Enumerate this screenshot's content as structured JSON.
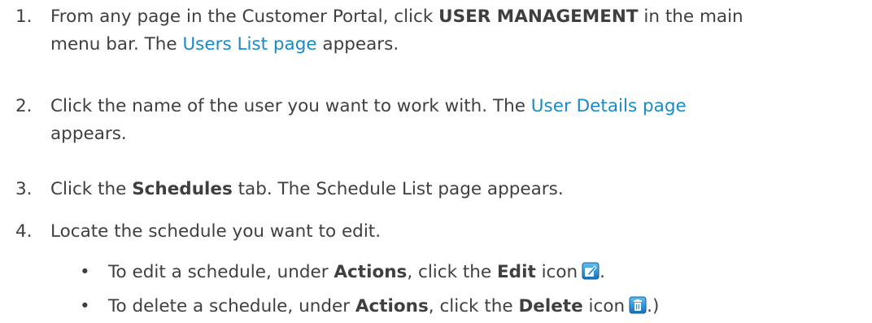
{
  "steps": [
    {
      "num": "1.",
      "a": "From any page in the Customer Portal, click ",
      "b": "USER MANAGEMENT",
      "c": " in the main",
      "d": "menu bar. The ",
      "link": "Users List page",
      "e": " appears."
    },
    {
      "num": "2.",
      "a": "Click the name of the user you want to work with. The ",
      "link": "User Details page",
      "b": "appears."
    },
    {
      "num": "3.",
      "a": "Click the ",
      "b": "Schedules",
      "c": " tab. The Schedule List page appears."
    },
    {
      "num": "4.",
      "a": "Locate the schedule you want to edit."
    }
  ],
  "bullets": [
    {
      "marker": "•",
      "a": "To edit a schedule, under ",
      "b": "Actions",
      "c": ", click the ",
      "d": "Edit",
      "e": " icon",
      "f": ".",
      "icon": "edit-icon",
      "icon_color": "#1e8fd6"
    },
    {
      "marker": "•",
      "a": "To delete a schedule, under ",
      "b": "Actions",
      "c": ", click the ",
      "d": "Delete",
      "e": " icon",
      "f": ".)",
      "icon": "delete-icon",
      "icon_color": "#1e8fd6"
    }
  ]
}
